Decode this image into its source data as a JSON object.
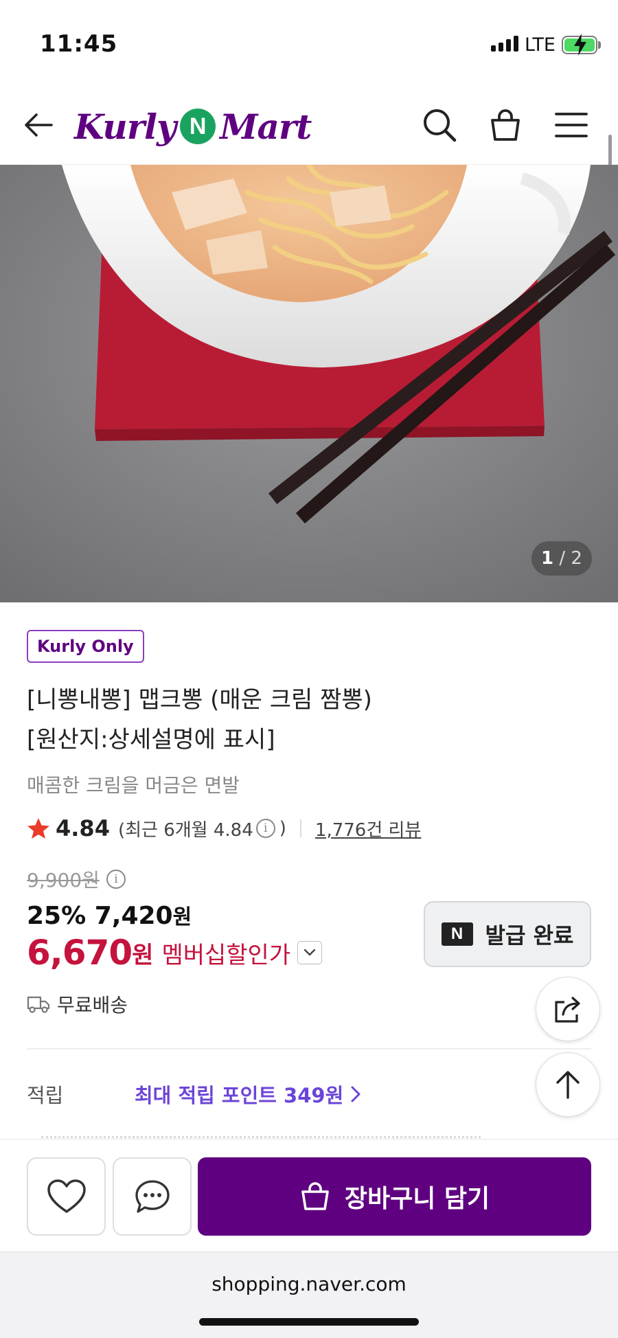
{
  "status_bar": {
    "time": "11:45",
    "network": "LTE"
  },
  "header": {
    "logo_left": "Kurly",
    "logo_mid": "N",
    "logo_right": "Mart"
  },
  "gallery": {
    "current": "1",
    "total": "/ 2"
  },
  "product": {
    "badge": "Kurly Only",
    "title_line1": "[니뽕내뽕] 맵크뽕 (매운 크림 짬뽕)",
    "title_line2": "[원산지:상세설명에 표시]",
    "subtitle": "매콤한 크림을 머금은 면발",
    "rating": "4.84",
    "rating_recent": "(최근 6개월 4.84",
    "rating_close": ")",
    "reviews": "1,776건 리뷰",
    "original_price": "9,900원",
    "discount_rate": "25%",
    "discount_price": "7,420",
    "discount_unit": "원",
    "member_price": "6,670",
    "member_unit": "원",
    "member_label": "멤버십할인가",
    "shipping": "무료배송",
    "points_label": "적립",
    "points_text": "최대 적립 포인트 349원"
  },
  "coupon": {
    "logo": "N",
    "label": "발급 완료"
  },
  "bottom_bar": {
    "cart_label": "장바구니 담기"
  },
  "browser": {
    "url": "shopping.naver.com"
  },
  "colors": {
    "brand": "#5f0080",
    "member_red": "#c4133d",
    "points_purple": "#6b45d8",
    "napkin": "#b81c34"
  }
}
